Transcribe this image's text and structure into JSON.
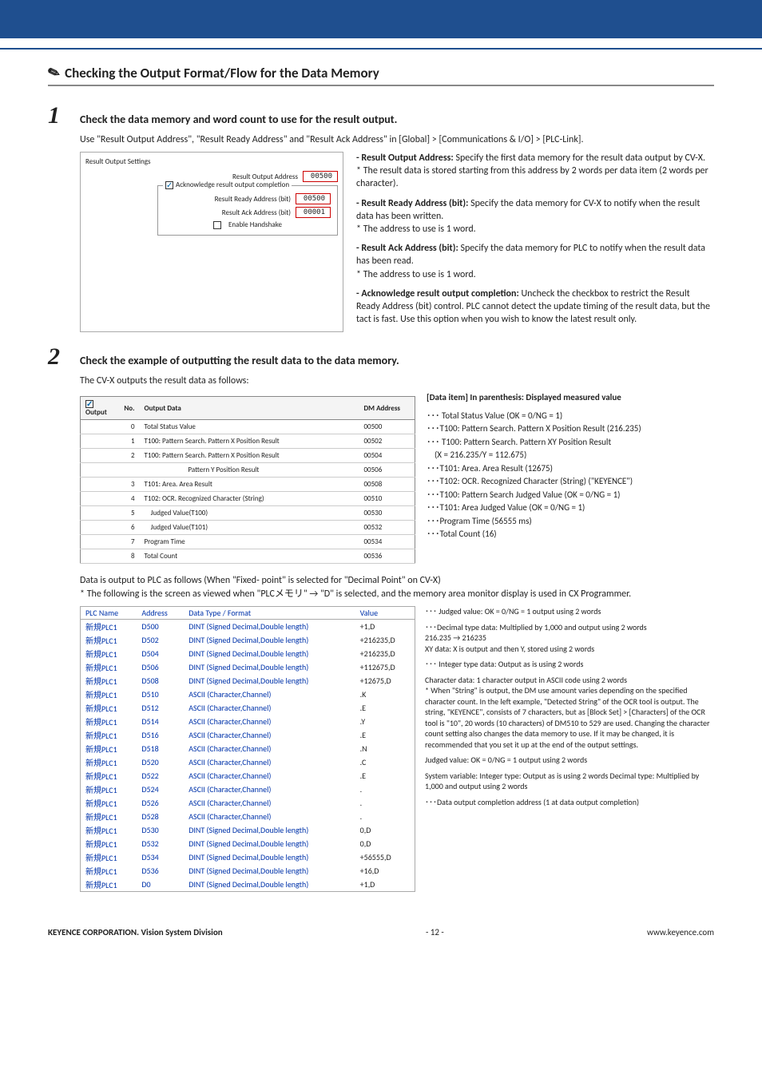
{
  "section_title": "Checking the Output Format/Flow for the Data Memory",
  "step1": {
    "title": "Check the data memory and word count to use for the result output.",
    "intro": "Use \"Result Output Address\", \"Result Ready Address\" and \"Result Ack Address\" in [Global] > [Communications & I/O] > [PLC-Link].",
    "panel": {
      "header": "Result Output Settings",
      "row1_label": "Result Output Address",
      "row1_val": "00500",
      "fieldset_legend": "Acknowledge result output completion",
      "row2_label": "Result Ready Address (bit)",
      "row2_val": "00500",
      "row3_label": "Result Ack Address (bit)",
      "row3_val": "00001",
      "handshake_label": "Enable Handshake"
    },
    "notes": {
      "a_head": "- Result Output Address: ",
      "a_body": "Specify the first data memory for the result data output by CV-X.\n* The result data is stored starting from this address by 2 words per data item (2 words per character).",
      "b_head": "- Result Ready Address (bit): ",
      "b_body": "Specify the data memory for CV-X to notify when the result data has been written.\n* The address to use is 1 word.",
      "c_head": "- Result Ack Address (bit): ",
      "c_body": "Specify the data memory for PLC to notify when the result data has been read.\n* The address to use is 1 word.",
      "d_head": "- Acknowledge result output completion: ",
      "d_body": "Uncheck the checkbox to restrict the Result Ready Address (bit) control. PLC cannot detect the update timing of the result data, but the tact is fast. Use this option when you wish to know the latest result only."
    }
  },
  "step2": {
    "title": "Check the example of outputting the result data to the data memory.",
    "intro": "The CV-X outputs the result data as follows:",
    "table_hdr": {
      "chk": "Output",
      "no": "No.",
      "data": "Output Data",
      "addr": "DM Address"
    },
    "rows": [
      {
        "no": "0",
        "data": "Total Status Value",
        "addr": "00500"
      },
      {
        "no": "1",
        "data": "T100: Pattern Search. Pattern X Position Result",
        "addr": "00502"
      },
      {
        "no": "2",
        "data": "T100: Pattern Search. Pattern X Position Result",
        "addr": "00504"
      },
      {
        "no": "",
        "data": "                           Pattern Y Position Result",
        "addr": "00506"
      },
      {
        "no": "3",
        "data": "T101: Area. Area Result",
        "addr": "00508"
      },
      {
        "no": "4",
        "data": "T102: OCR. Recognized Character (String)",
        "addr": "00510"
      },
      {
        "no": "5",
        "data": "    Judged Value(T100)",
        "addr": "00530"
      },
      {
        "no": "6",
        "data": "    Judged Value(T101)",
        "addr": "00532"
      },
      {
        "no": "7",
        "data": "Program Time",
        "addr": "00534"
      },
      {
        "no": "8",
        "data": "Total Count",
        "addr": "00536"
      }
    ],
    "right_hdr": "[Data item] In parenthesis: Displayed measured value",
    "right_items": [
      "･･･ Total Status Value (OK = 0/NG = 1)",
      "･･･T100: Pattern Search. Pattern X Position Result (216.235)",
      "･･･ T100: Pattern Search. Pattern XY Position Result\n    (X = 216.235/Y = 112.675)",
      "･･･T101: Area. Area Result (12675)",
      "･･･T102: OCR. Recognized Character (String) (\"KEYENCE\")",
      "･･･T100: Pattern Search Judged Value (OK = 0/NG = 1)",
      "･･･T101: Area Judged Value (OK = 0/NG = 1)",
      "･･･Program Time (56555 ms)",
      "･･･Total Count (16)"
    ],
    "plc_intro1": "Data is output to PLC as follows (When \"Fixed- point\" is selected for \"Decimal Point\" on CV-X)",
    "plc_intro2": "* The following is the screen as viewed when \"PLCメモリ\" → \"D\" is selected, and the memory area monitor display is used in CX Programmer.",
    "plc_hdr": {
      "name": "PLC Name",
      "addr": "Address",
      "type": "Data Type / Format",
      "val": "Value"
    },
    "plc_rows": [
      {
        "name": "新規PLC1",
        "addr": "D500",
        "type": "DINT (Signed Decimal,Double length)",
        "val": "+1,D"
      },
      {
        "name": "新規PLC1",
        "addr": "D502",
        "type": "DINT (Signed Decimal,Double length)",
        "val": "+216235,D"
      },
      {
        "name": "新規PLC1",
        "addr": "D504",
        "type": "DINT (Signed Decimal,Double length)",
        "val": "+216235,D"
      },
      {
        "name": "新規PLC1",
        "addr": "D506",
        "type": "DINT (Signed Decimal,Double length)",
        "val": "+112675,D"
      },
      {
        "name": "新規PLC1",
        "addr": "D508",
        "type": "DINT (Signed Decimal,Double length)",
        "val": "+12675,D"
      },
      {
        "name": "新規PLC1",
        "addr": "D510",
        "type": "ASCII (Character,Channel)",
        "val": ".K"
      },
      {
        "name": "新規PLC1",
        "addr": "D512",
        "type": "ASCII (Character,Channel)",
        "val": ".E"
      },
      {
        "name": "新規PLC1",
        "addr": "D514",
        "type": "ASCII (Character,Channel)",
        "val": ".Y"
      },
      {
        "name": "新規PLC1",
        "addr": "D516",
        "type": "ASCII (Character,Channel)",
        "val": ".E"
      },
      {
        "name": "新規PLC1",
        "addr": "D518",
        "type": "ASCII (Character,Channel)",
        "val": ".N"
      },
      {
        "name": "新規PLC1",
        "addr": "D520",
        "type": "ASCII (Character,Channel)",
        "val": ".C"
      },
      {
        "name": "新規PLC1",
        "addr": "D522",
        "type": "ASCII (Character,Channel)",
        "val": ".E"
      },
      {
        "name": "新規PLC1",
        "addr": "D524",
        "type": "ASCII (Character,Channel)",
        "val": "."
      },
      {
        "name": "新規PLC1",
        "addr": "D526",
        "type": "ASCII (Character,Channel)",
        "val": "."
      },
      {
        "name": "新規PLC1",
        "addr": "D528",
        "type": "ASCII (Character,Channel)",
        "val": "."
      },
      {
        "name": "新規PLC1",
        "addr": "D530",
        "type": "DINT (Signed Decimal,Double length)",
        "val": "0,D"
      },
      {
        "name": "新規PLC1",
        "addr": "D532",
        "type": "DINT (Signed Decimal,Double length)",
        "val": "0,D"
      },
      {
        "name": "新規PLC1",
        "addr": "D534",
        "type": "DINT (Signed Decimal,Double length)",
        "val": "+56555,D"
      },
      {
        "name": "新規PLC1",
        "addr": "D536",
        "type": "DINT (Signed Decimal,Double length)",
        "val": "+16,D"
      },
      {
        "name": "新規PLC1",
        "addr": "D0",
        "type": "DINT (Signed Decimal,Double length)",
        "val": "+1,D"
      }
    ],
    "plc_notes": [
      "･･･ Judged value: OK = 0/NG = 1 output using 2 words",
      "･･･Decimal type data: Multiplied by 1,000 and output using 2 words\n                                          216.235 → 216235\n    XY data: X is output and then Y, stored using 2 words",
      "･･･ Integer type data: Output as is using 2 words",
      "Character data: 1 character output in ASCII code using 2 words\n* When \"String\" is output, the DM use amount varies depending on the specified character count. In the left example, \"Detected String\" of the OCR tool is output. The string, \"KEYENCE\", consists of 7 characters, but as [Block Set] > [Characters] of the OCR tool is \"10\", 20 words (10 characters) of DM510 to 529 are used. Changing the character count setting also changes the data memory to use. If it may be changed, it is recommended that you set it up at the end of the output settings.",
      "Judged value: OK = 0/NG = 1 output using 2 words",
      "System variable: Integer type: Output as is using 2 words  Decimal type: Multiplied by 1,000 and output using 2 words",
      "･･･Data output completion address (1 at data output completion)"
    ]
  },
  "footer": {
    "left": "KEYENCE CORPORATION. Vision System Division",
    "center": "- 12 -",
    "right": "www.keyence.com"
  }
}
